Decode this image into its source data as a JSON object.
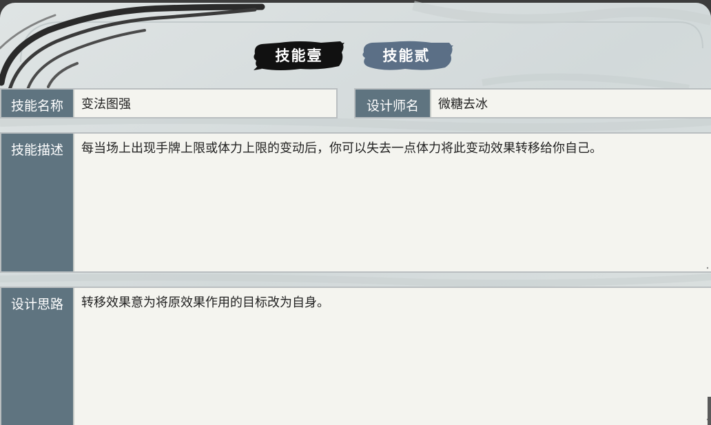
{
  "tabs": [
    {
      "label": "技能壹",
      "active": true
    },
    {
      "label": "技能贰",
      "active": false
    }
  ],
  "skill_name": {
    "label": "技能名称",
    "value": "变法图强"
  },
  "designer": {
    "label": "设计师名",
    "value": "微糖去冰"
  },
  "skill_description": {
    "label": "技能描述",
    "value": "每当场上出现手牌上限或体力上限的变动后，你可以失去一点体力将此变动效果转移给你自己。"
  },
  "design_idea": {
    "label": "设计思路",
    "value": "转移效果意为将原效果作用的目标改为自身。"
  },
  "colors": {
    "label_bg": "#5f7480",
    "field_bg": "#f4f4ef",
    "tab_active": "#111111",
    "tab_inactive": "#5b6f86",
    "panel_bg": "#d6dcdc"
  }
}
